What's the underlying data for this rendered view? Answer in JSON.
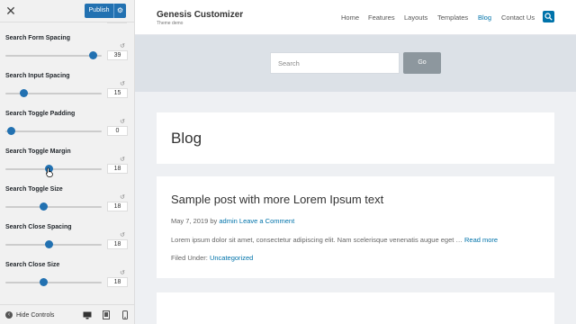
{
  "sidebar": {
    "publish_label": "Publish",
    "peek_value": "300",
    "controls": [
      {
        "label": "Search Form Spacing",
        "value": "39",
        "level": 0.91
      },
      {
        "label": "Search Input Spacing",
        "value": "15",
        "level": 0.19
      },
      {
        "label": "Search Toggle Padding",
        "value": "0",
        "level": 0.06
      },
      {
        "label": "Search Toggle Margin",
        "value": "18",
        "level": 0.45
      },
      {
        "label": "Search Toggle Size",
        "value": "18",
        "level": 0.4
      },
      {
        "label": "Search Close Spacing",
        "value": "18",
        "level": 0.45
      },
      {
        "label": "Search Close Size",
        "value": "18",
        "level": 0.4
      }
    ],
    "hide_controls_label": "Hide Controls",
    "accent_color": "#2271b1"
  },
  "site": {
    "title": "Genesis Customizer",
    "tagline": "Theme demo",
    "nav": [
      "Home",
      "Features",
      "Layouts",
      "Templates",
      "Blog",
      "Contact Us"
    ],
    "active_nav": "Blog",
    "search_placeholder": "Search",
    "search_button": "Go",
    "link_color": "#0073aa"
  },
  "blog": {
    "heading": "Blog",
    "post": {
      "title": "Sample post with more Lorem Ipsum text",
      "date": "May 7, 2019",
      "by": " by ",
      "author": "admin",
      "comments": "Leave a Comment",
      "excerpt": "Lorem ipsum dolor sit amet, consectetur adipiscing elit. Nam scelerisque venenatis augue eget … ",
      "read_more": "Read more",
      "filed_label": "Filed Under: ",
      "category": "Uncategorized"
    }
  }
}
